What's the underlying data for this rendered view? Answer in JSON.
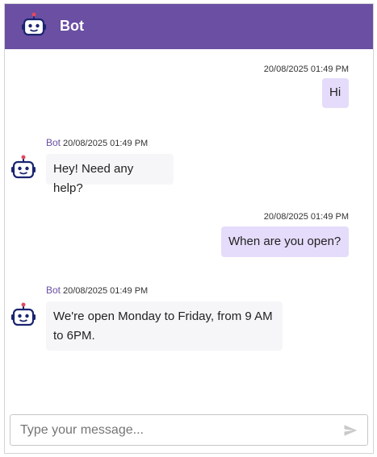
{
  "header": {
    "title": "Bot",
    "icon": "robot-icon",
    "color": "#6a4fa3"
  },
  "messages": [
    {
      "from": "user",
      "time": "20/08/2025 01:49 PM",
      "text": "Hi"
    },
    {
      "from": "bot",
      "sender": "Bot",
      "time": "20/08/2025 01:49 PM",
      "text": "Hey! Need any help?"
    },
    {
      "from": "user",
      "time": "20/08/2025 01:49 PM",
      "text": "When are you open?"
    },
    {
      "from": "bot",
      "sender": "Bot",
      "time": "20/08/2025 01:49 PM",
      "text": "We're open Monday to Friday, from 9 AM to 6PM."
    }
  ],
  "composer": {
    "placeholder": "Type your message...",
    "value": "",
    "send_icon": "send-icon"
  },
  "colors": {
    "user_bubble": "#e5dcfb",
    "bot_bubble": "#f6f6f9",
    "accent": "#6a4fa3"
  }
}
